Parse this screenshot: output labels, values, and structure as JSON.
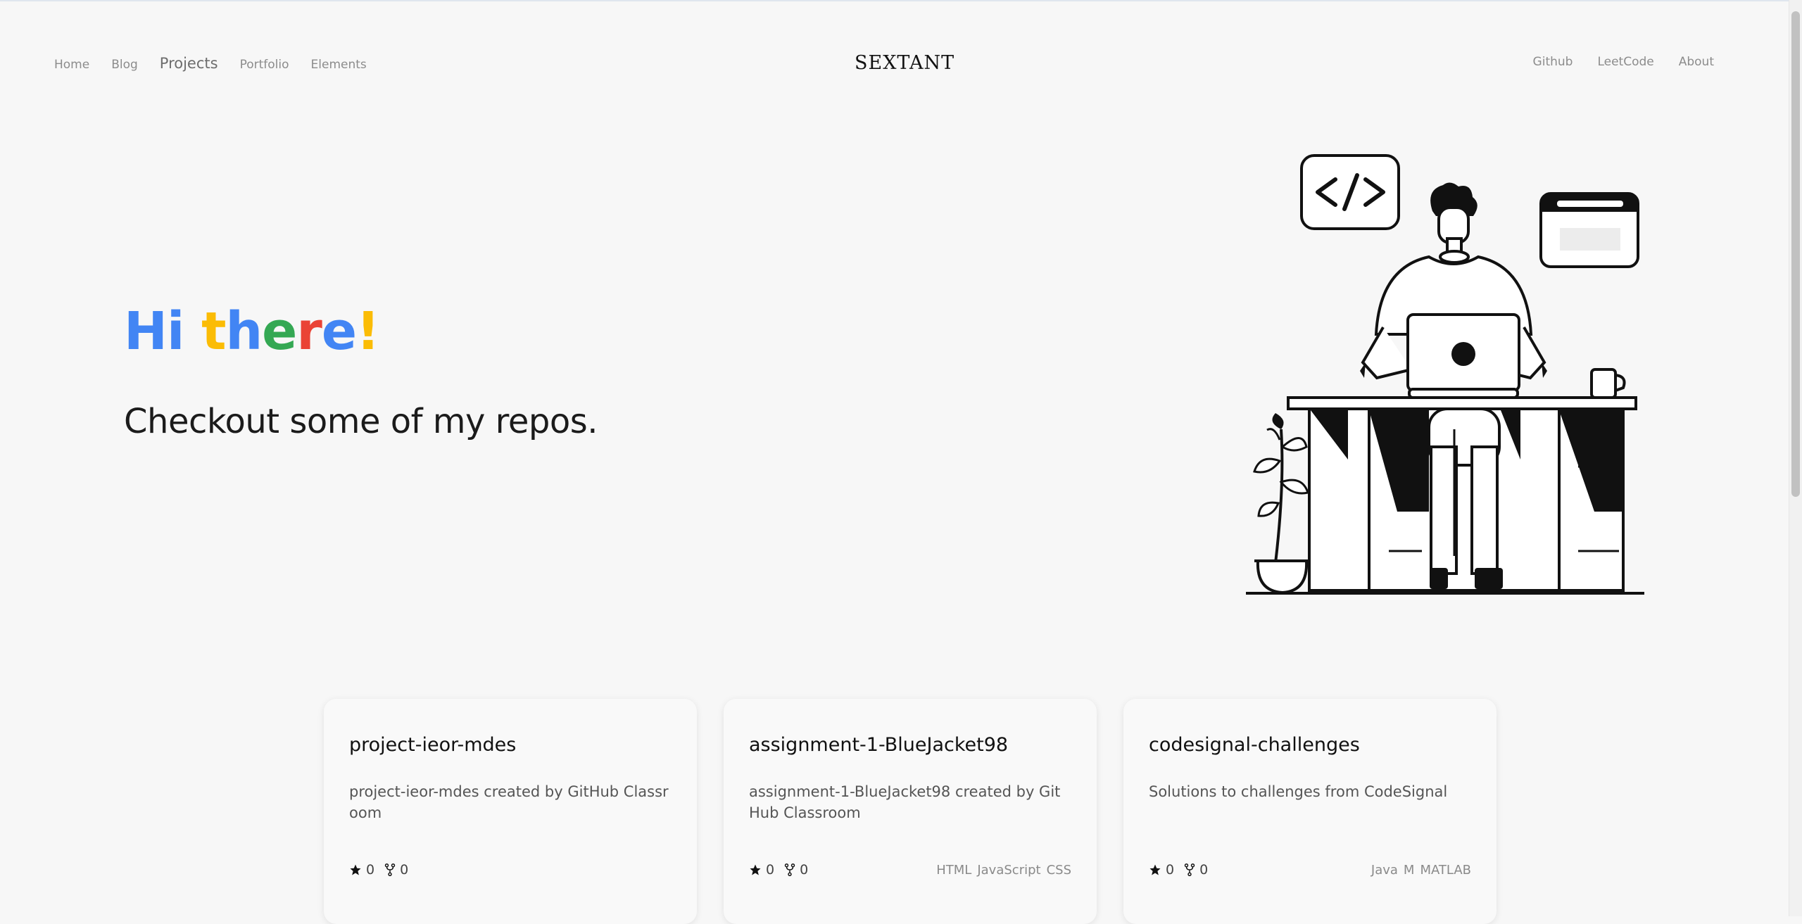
{
  "nav": {
    "left": [
      "Home",
      "Blog",
      "Projects",
      "Portfolio",
      "Elements"
    ],
    "active": "Projects",
    "brand": "SEXTANT",
    "right": [
      "Github",
      "LeetCode",
      "About"
    ]
  },
  "hero": {
    "title_letters": [
      {
        "ch": "H",
        "color": "#4285f4"
      },
      {
        "ch": "i",
        "color": "#4285f4"
      },
      {
        "ch": " ",
        "color": "#000000"
      },
      {
        "ch": "t",
        "color": "#fbbc05"
      },
      {
        "ch": "h",
        "color": "#4285f4"
      },
      {
        "ch": "e",
        "color": "#34a853"
      },
      {
        "ch": "r",
        "color": "#ea4335"
      },
      {
        "ch": "e",
        "color": "#4285f4"
      },
      {
        "ch": "!",
        "color": "#fbbc05"
      }
    ],
    "subtitle": "Checkout some of my repos."
  },
  "repos": [
    {
      "name": "project-ieor-mdes",
      "description": "project-ieor-mdes created by GitHub Classroom",
      "stars": "0",
      "forks": "0",
      "languages": []
    },
    {
      "name": "assignment-1-BlueJacket98",
      "description": "assignment-1-BlueJacket98 created by GitHub Classroom",
      "stars": "0",
      "forks": "0",
      "languages": [
        "HTML",
        "JavaScript",
        "CSS"
      ]
    },
    {
      "name": "codesignal-challenges",
      "description": "Solutions to challenges from CodeSignal",
      "stars": "0",
      "forks": "0",
      "languages": [
        "Java",
        "M",
        "MATLAB"
      ]
    }
  ],
  "icons": {
    "star": "star-icon",
    "fork": "fork-icon",
    "code": "code-icon"
  }
}
